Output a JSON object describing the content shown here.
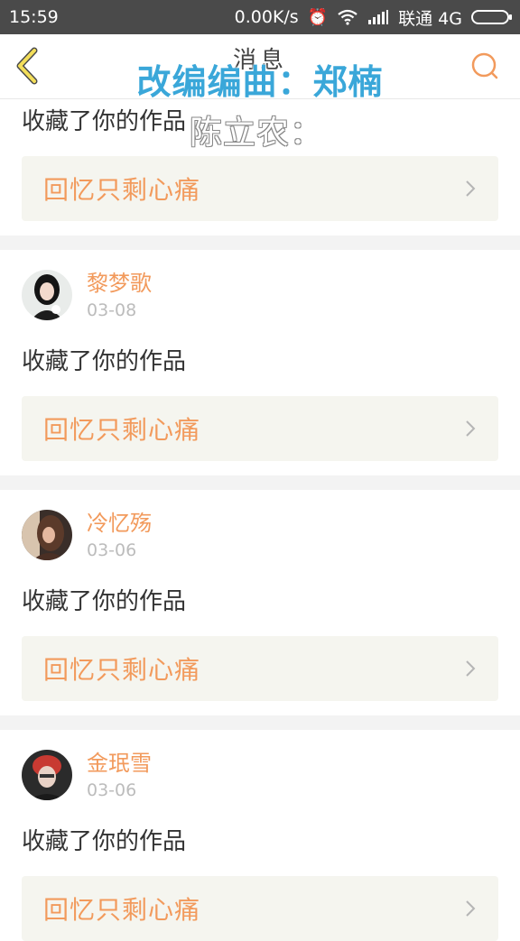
{
  "status_bar": {
    "time": "15:59",
    "network_speed": "0.00K/s",
    "carrier": "联通 4G",
    "icons": [
      "alarm-icon",
      "wifi-icon",
      "signal-icon",
      "battery-icon"
    ]
  },
  "nav": {
    "title": "消息",
    "back_icon": "chevron-left-icon",
    "search_icon": "search-icon"
  },
  "overlay": {
    "line1": "改编编曲：郑楠",
    "line2": "陈立农："
  },
  "colors": {
    "accent": "#f29a5c",
    "back_icon": "#e0c94f",
    "card_bg": "#f5f5ef",
    "overlay_blue": "#3aa7d9"
  },
  "first_item": {
    "action": "收藏了你的作品",
    "work_title": "回忆只剩心痛"
  },
  "items": [
    {
      "username": "黎梦歌",
      "date": "03-08",
      "action": "收藏了你的作品",
      "work_title": "回忆只剩心痛"
    },
    {
      "username": "冷忆殇",
      "date": "03-06",
      "action": "收藏了你的作品",
      "work_title": "回忆只剩心痛"
    },
    {
      "username": "金珉雪",
      "date": "03-06",
      "action": "收藏了你的作品",
      "work_title": "回忆只剩心痛"
    }
  ]
}
